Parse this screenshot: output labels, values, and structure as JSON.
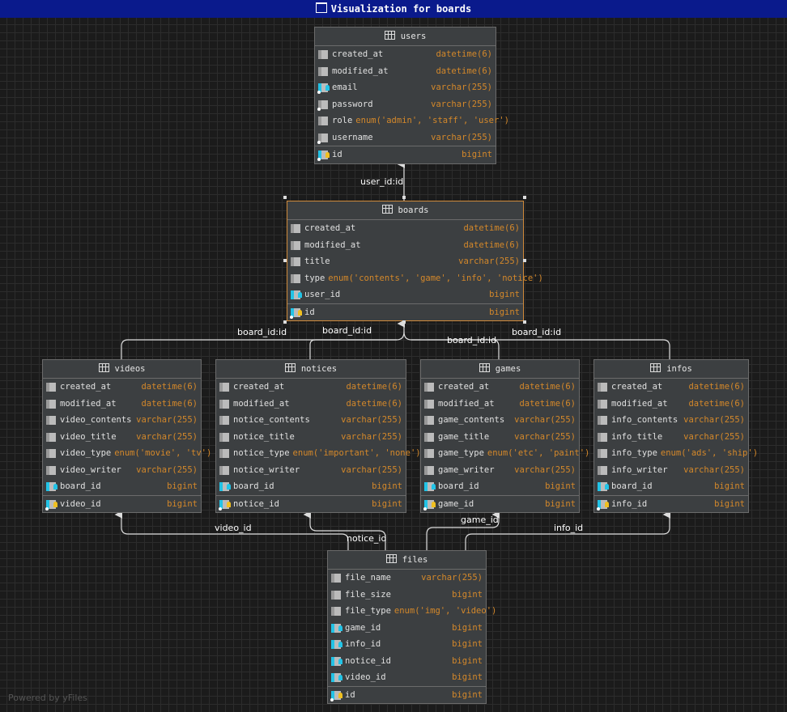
{
  "window": {
    "title": "Visualization for boards"
  },
  "footer": "Powered by yFiles",
  "tables": [
    {
      "name": "users",
      "fields": [
        [
          "created_at",
          "datetime(6)",
          "col"
        ],
        [
          "modified_at",
          "datetime(6)",
          "col"
        ],
        [
          "email",
          "varchar(255)",
          "uq"
        ],
        [
          "password",
          "varchar(255)",
          "nn"
        ],
        [
          "role",
          "enum('admin', 'staff', 'user')",
          "col"
        ],
        [
          "username",
          "varchar(255)",
          "nn"
        ],
        [
          "id",
          "bigint",
          "pk"
        ]
      ]
    },
    {
      "name": "boards",
      "fields": [
        [
          "created_at",
          "datetime(6)",
          "col"
        ],
        [
          "modified_at",
          "datetime(6)",
          "col"
        ],
        [
          "title",
          "varchar(255)",
          "col"
        ],
        [
          "type",
          "enum('contents', 'game', 'info', 'notice')",
          "col"
        ],
        [
          "user_id",
          "bigint",
          "fk"
        ],
        [
          "id",
          "bigint",
          "pk"
        ]
      ]
    },
    {
      "name": "videos",
      "fields": [
        [
          "created_at",
          "datetime(6)",
          "col"
        ],
        [
          "modified_at",
          "datetime(6)",
          "col"
        ],
        [
          "video_contents",
          "varchar(255)",
          "col"
        ],
        [
          "video_title",
          "varchar(255)",
          "col"
        ],
        [
          "video_type",
          "enum('movie', 'tv')",
          "col"
        ],
        [
          "video_writer",
          "varchar(255)",
          "col"
        ],
        [
          "board_id",
          "bigint",
          "fk"
        ],
        [
          "video_id",
          "bigint",
          "pk"
        ]
      ]
    },
    {
      "name": "notices",
      "fields": [
        [
          "created_at",
          "datetime(6)",
          "col"
        ],
        [
          "modified_at",
          "datetime(6)",
          "col"
        ],
        [
          "notice_contents",
          "varchar(255)",
          "col"
        ],
        [
          "notice_title",
          "varchar(255)",
          "col"
        ],
        [
          "notice_type",
          "enum('important', 'none')",
          "col"
        ],
        [
          "notice_writer",
          "varchar(255)",
          "col"
        ],
        [
          "board_id",
          "bigint",
          "fk"
        ],
        [
          "notice_id",
          "bigint",
          "pk"
        ]
      ]
    },
    {
      "name": "games",
      "fields": [
        [
          "created_at",
          "datetime(6)",
          "col"
        ],
        [
          "modified_at",
          "datetime(6)",
          "col"
        ],
        [
          "game_contents",
          "varchar(255)",
          "col"
        ],
        [
          "game_title",
          "varchar(255)",
          "col"
        ],
        [
          "game_type",
          "enum('etc', 'paint')",
          "col"
        ],
        [
          "game_writer",
          "varchar(255)",
          "col"
        ],
        [
          "board_id",
          "bigint",
          "fk"
        ],
        [
          "game_id",
          "bigint",
          "pk"
        ]
      ]
    },
    {
      "name": "infos",
      "fields": [
        [
          "created_at",
          "datetime(6)",
          "col"
        ],
        [
          "modified_at",
          "datetime(6)",
          "col"
        ],
        [
          "info_contents",
          "varchar(255)",
          "col"
        ],
        [
          "info_title",
          "varchar(255)",
          "col"
        ],
        [
          "info_type",
          "enum('ads', 'ship')",
          "col"
        ],
        [
          "info_writer",
          "varchar(255)",
          "col"
        ],
        [
          "board_id",
          "bigint",
          "fk"
        ],
        [
          "info_id",
          "bigint",
          "pk"
        ]
      ]
    },
    {
      "name": "files",
      "fields": [
        [
          "file_name",
          "varchar(255)",
          "col"
        ],
        [
          "file_size",
          "bigint",
          "col"
        ],
        [
          "file_type",
          "enum('img', 'video')",
          "col"
        ],
        [
          "game_id",
          "bigint",
          "fk"
        ],
        [
          "info_id",
          "bigint",
          "fk"
        ],
        [
          "notice_id",
          "bigint",
          "fk"
        ],
        [
          "video_id",
          "bigint",
          "fk"
        ],
        [
          "id",
          "bigint",
          "pk"
        ]
      ]
    }
  ],
  "edges": [
    "user_id:id",
    "board_id:id",
    "board_id:id",
    "board_id:id",
    "board_id:id",
    "video_id",
    "notice_id",
    "game_id",
    "info_id"
  ]
}
